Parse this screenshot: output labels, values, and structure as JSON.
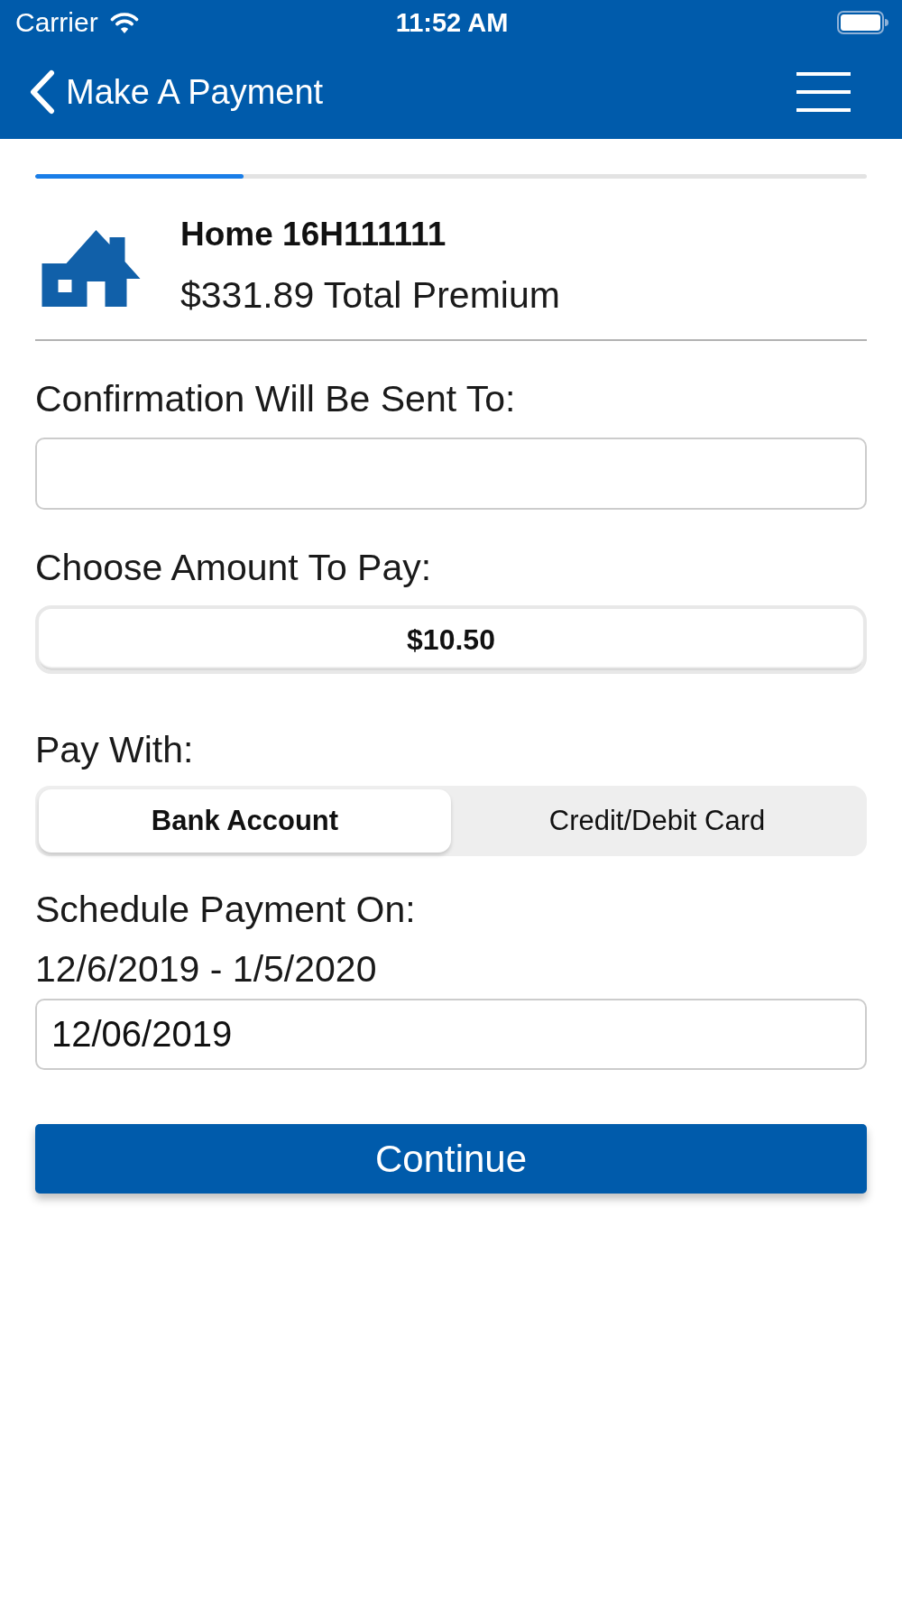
{
  "status_bar": {
    "carrier": "Carrier",
    "time": "11:52 AM"
  },
  "nav_bar": {
    "title": "Make A Payment"
  },
  "progress": {
    "level": 0.25
  },
  "policy": {
    "title": "Home 16H111111",
    "subtitle": "$331.89 Total Premium"
  },
  "form": {
    "email": {
      "label": "Confirmation Will Be Sent To:"
    },
    "amount": {
      "label": "Choose Amount To Pay:",
      "value": "$10.50"
    },
    "pay_with": {
      "label": "Pay With:",
      "options": [
        {
          "label": "Bank Account",
          "selected": true
        },
        {
          "label": "Credit/Debit Card",
          "selected": false
        }
      ]
    },
    "schedule": {
      "label": "Schedule Payment On:",
      "range": "12/6/2019 - 1/5/2020",
      "value": "12/06/2019"
    }
  },
  "continue_button": {
    "label": "Continue"
  }
}
